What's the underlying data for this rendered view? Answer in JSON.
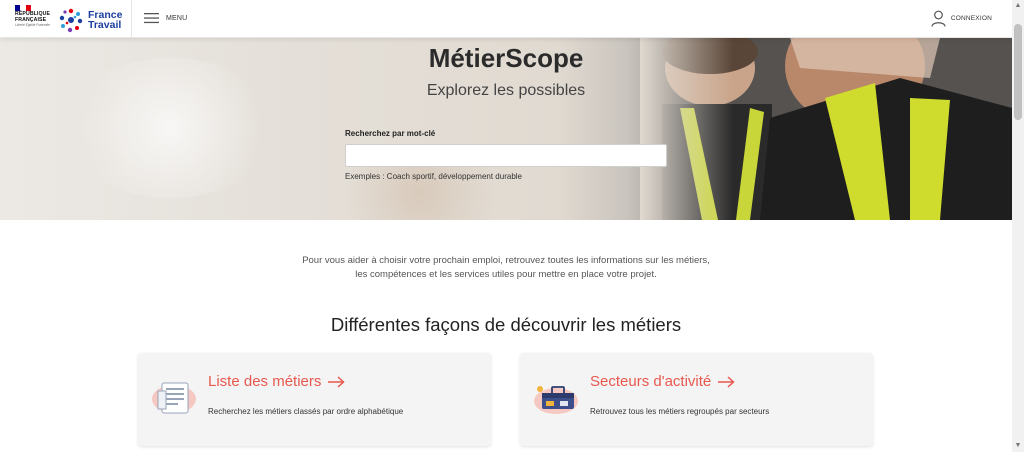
{
  "header": {
    "republique": "RÉPUBLIQUE FRANÇAISE",
    "motto": "Liberté Égalité Fraternité",
    "brand_line1": "France",
    "brand_line2": "Travail",
    "menu_label": "MENU",
    "login_label": "CONNEXION",
    "icons": {
      "menu": "hamburger-icon",
      "login": "user-icon",
      "logo": "france-travail-logo"
    }
  },
  "hero": {
    "title": "MétierScope",
    "subtitle": "Explorez les possibles",
    "search_label": "Recherchez par mot-clé",
    "search_value": "",
    "search_placeholder": "",
    "examples": "Exemples : Coach sportif, développement durable"
  },
  "intro": {
    "text": "Pour vous aider à choisir votre prochain emploi, retrouvez toutes les informations sur les métiers, les compétences et les services utiles pour mettre en place votre projet."
  },
  "section": {
    "title": "Différentes façons de découvrir les métiers"
  },
  "cards": [
    {
      "title": "Liste des métiers",
      "description": "Recherchez les métiers classés par ordre alphabétique",
      "icon": "document-list-icon"
    },
    {
      "title": "Secteurs d'activité",
      "description": "Retrouvez tous les métiers regroupés par secteurs",
      "icon": "toolbox-icon"
    }
  ],
  "colors": {
    "accent": "#e8584f",
    "brand_blue": "#1b3ea0",
    "flag_blue": "#000091",
    "flag_red": "#e1000f"
  }
}
